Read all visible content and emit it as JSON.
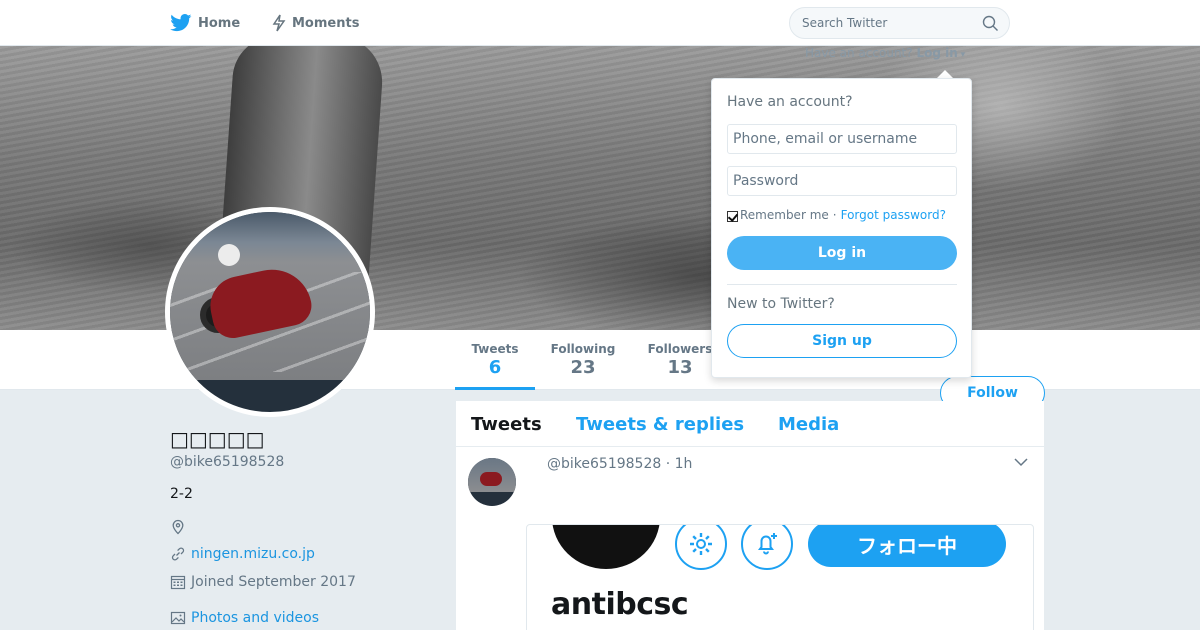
{
  "nav": {
    "home_label": "Home",
    "moments_label": "Moments",
    "search_placeholder": "Search Twitter",
    "have_account": "Have an account?",
    "login_link": "Log in"
  },
  "profile": {
    "name": "□□□□□",
    "handle": "@bike65198528",
    "bio": "2-2",
    "url": "ningen.mizu.co.jp",
    "joined": "Joined September 2017",
    "photos_label": "Photos and videos",
    "follow_label": "Follow"
  },
  "stats": [
    {
      "label": "Tweets",
      "value": "6"
    },
    {
      "label": "Following",
      "value": "23"
    },
    {
      "label": "Followers",
      "value": "13"
    }
  ],
  "timeline": {
    "tabs": [
      "Tweets",
      "Tweets & replies",
      "Media"
    ],
    "tweet": {
      "meta": "@bike65198528 · 1h",
      "card_follow_label": "フォロー中",
      "card_name": "antibcsc"
    }
  },
  "login_dropdown": {
    "title": "Have an account?",
    "username_placeholder": "Phone, email or username",
    "password_placeholder": "Password",
    "remember_label": "Remember me",
    "separator": "·",
    "forgot_label": "Forgot password?",
    "login_button": "Log in",
    "new_label": "New to Twitter?",
    "signup_button": "Sign up"
  },
  "colors": {
    "accent": "#1da1f2",
    "link": "#1b95e0",
    "muted": "#657786",
    "background": "#e6ecf0"
  },
  "icons": [
    "twitter-bird-icon",
    "moments-bolt-icon",
    "search-icon",
    "location-icon",
    "link-icon",
    "calendar-icon",
    "photo-icon",
    "chevron-down-icon",
    "gear-icon",
    "bell-plus-icon"
  ]
}
